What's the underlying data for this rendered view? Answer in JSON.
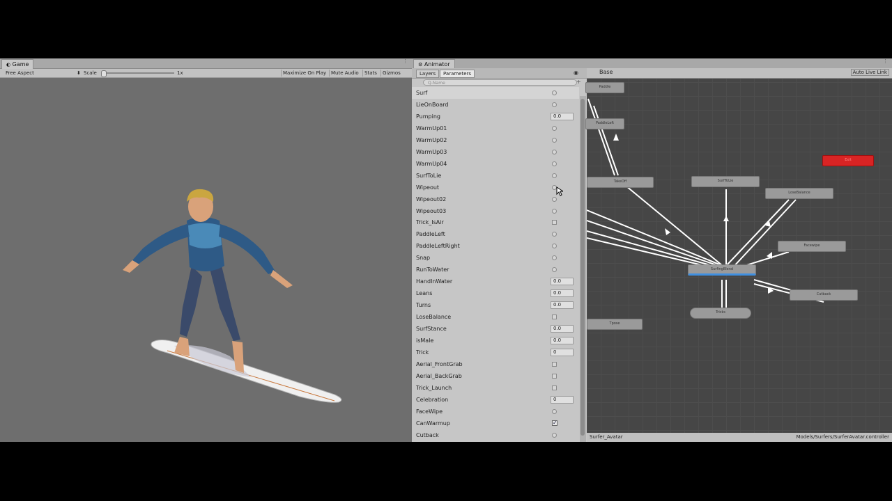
{
  "game": {
    "tab_title": "Game",
    "aspect": "Free Aspect",
    "scale_label": "Scale",
    "scale_value": "1x",
    "buttons": [
      "Maximize On Play",
      "Mute Audio",
      "Stats",
      "Gizmos"
    ]
  },
  "animator": {
    "tab_title": "Animator",
    "subtabs": [
      "Layers",
      "Parameters"
    ],
    "search_placeholder": "Q-Name",
    "layer_name": "Base",
    "auto_live_link": "Auto Live Link",
    "status_left": "Surfer_Avatar",
    "status_right": "Models/Surfers/SurferAvatar.controller",
    "parameters": [
      {
        "name": "Surf",
        "kind": "bool",
        "value": ""
      },
      {
        "name": "LieOnBoard",
        "kind": "bool",
        "value": ""
      },
      {
        "name": "Pumping",
        "kind": "float",
        "value": "0.0"
      },
      {
        "name": "WarmUp01",
        "kind": "bool",
        "value": ""
      },
      {
        "name": "WarmUp02",
        "kind": "bool",
        "value": ""
      },
      {
        "name": "WarmUp03",
        "kind": "bool",
        "value": ""
      },
      {
        "name": "WarmUp04",
        "kind": "bool",
        "value": ""
      },
      {
        "name": "SurfToLie",
        "kind": "bool",
        "value": ""
      },
      {
        "name": "Wipeout",
        "kind": "bool",
        "value": ""
      },
      {
        "name": "Wipeout02",
        "kind": "bool",
        "value": ""
      },
      {
        "name": "Wipeout03",
        "kind": "bool",
        "value": ""
      },
      {
        "name": "Trick_IsAir",
        "kind": "trigger",
        "value": ""
      },
      {
        "name": "PaddleLeft",
        "kind": "bool",
        "value": ""
      },
      {
        "name": "PaddleLeftRight",
        "kind": "bool",
        "value": ""
      },
      {
        "name": "Snap",
        "kind": "bool",
        "value": ""
      },
      {
        "name": "RunToWater",
        "kind": "bool",
        "value": ""
      },
      {
        "name": "HandInWater",
        "kind": "float",
        "value": "0.0"
      },
      {
        "name": "Leans",
        "kind": "float",
        "value": "0.0"
      },
      {
        "name": "Turns",
        "kind": "float",
        "value": "0.0"
      },
      {
        "name": "LoseBalance",
        "kind": "trigger",
        "value": ""
      },
      {
        "name": "SurfStance",
        "kind": "float",
        "value": "0.0"
      },
      {
        "name": "isMale",
        "kind": "float",
        "value": "0.0"
      },
      {
        "name": "Trick",
        "kind": "int",
        "value": "0"
      },
      {
        "name": "Aerial_FrontGrab",
        "kind": "trigger",
        "value": ""
      },
      {
        "name": "Aerial_BackGrab",
        "kind": "trigger",
        "value": ""
      },
      {
        "name": "Trick_Launch",
        "kind": "trigger",
        "value": ""
      },
      {
        "name": "Celebration",
        "kind": "int",
        "value": "0"
      },
      {
        "name": "FaceWipe",
        "kind": "bool",
        "value": ""
      },
      {
        "name": "CanWarmup",
        "kind": "checked",
        "value": "✓"
      },
      {
        "name": "Cutback",
        "kind": "bool",
        "value": ""
      }
    ],
    "nodes": {
      "n1": "Paddle",
      "n2": "PaddleLeft",
      "takeoff": "TakeOff",
      "surftolie": "SurfToLie",
      "losebalance": "LoseBalance",
      "exit": "Exit",
      "facewipe": "Facewipe",
      "surfingblend": "SurfingBlend",
      "cutback": "Cutback",
      "tricks": "Tricks",
      "tpose": "Tpose"
    }
  }
}
